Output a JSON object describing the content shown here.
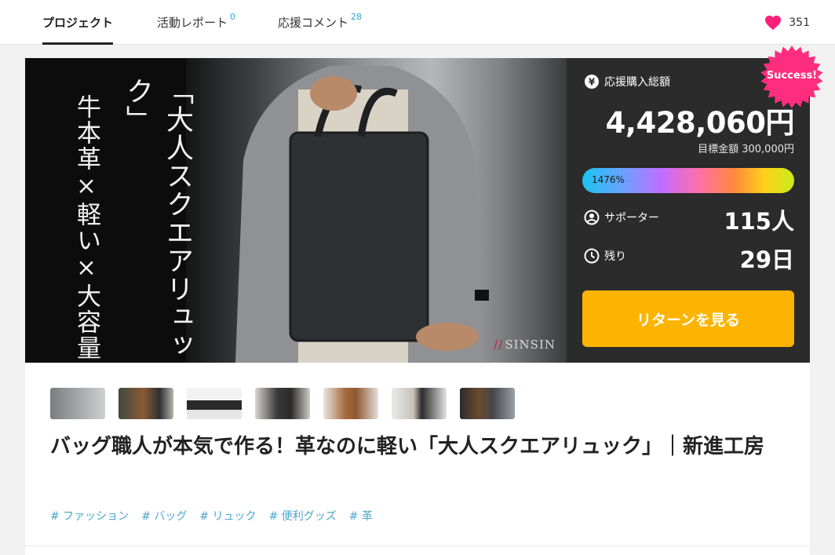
{
  "nav": {
    "tabs": [
      {
        "label": "プロジェクト",
        "count": ""
      },
      {
        "label": "活動レポート",
        "count": "0"
      },
      {
        "label": "応援コメント",
        "count": "28"
      }
    ],
    "like_count": "351"
  },
  "hero": {
    "headline": "「大人スクエアリュック」",
    "subline": "牛本革×軽い×大容量",
    "brand": "SINSIN"
  },
  "stats": {
    "badge": "Success!",
    "total_label": "応援購入総額",
    "total_amount": "4,428,060円",
    "goal_text": "目標金額 300,000円",
    "progress_text": "1476%",
    "progress_percent": 1476,
    "supporters_label": "サポーター",
    "supporters_value": "115人",
    "remaining_label": "残り",
    "remaining_value": "29日",
    "cta_label": "リターンを見る"
  },
  "project": {
    "thumbnails": [
      "thumb-1",
      "thumb-2",
      "thumb-3",
      "thumb-4",
      "thumb-5",
      "thumb-6",
      "thumb-7"
    ],
    "title": "バッグ職人が本気で作る！革なのに軽い「大人スクエアリュック」｜新進工房",
    "tags": [
      "# ファッション",
      "# バッグ",
      "# リュック",
      "# 便利グッズ",
      "# 革"
    ]
  },
  "colors": {
    "heart": "#ff1f7a",
    "badge": "#ff2d7d",
    "cta": "#fdb400",
    "tag": "#4ba6cf",
    "panel": "#2b2b2b"
  }
}
